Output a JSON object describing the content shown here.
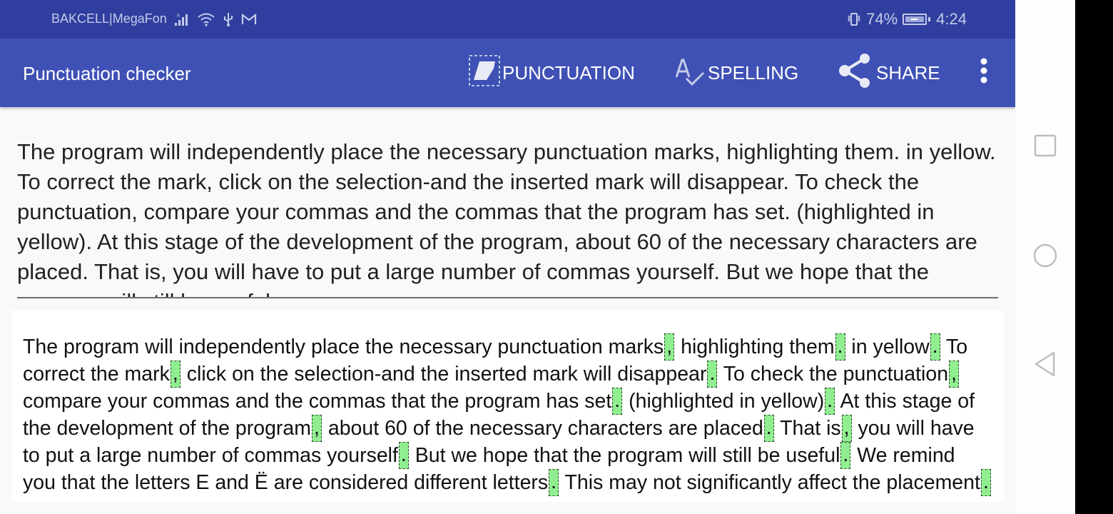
{
  "status_bar": {
    "carrier": "BAKCELL|MegaFon",
    "battery_percent": "74%",
    "time": "4:24",
    "icons_left": [
      "signal-icon",
      "wifi-icon",
      "usb-icon",
      "gmail-icon"
    ],
    "icons_right": [
      "vibrate-icon",
      "battery-charging-icon"
    ]
  },
  "app_bar": {
    "title": "Punctuation checker",
    "actions": {
      "punctuation": "PUNCTUATION",
      "spelling": "SPELLING",
      "share": "SHARE"
    }
  },
  "input": {
    "text": "The program will independently place the necessary punctuation marks, highlighting them. in yellow. To correct the mark, click on the selection-and the inserted mark will disappear. To check the punctuation, compare your commas and the commas that the program has set. (highlighted in yellow). At this stage of the development of the program, about 60 of the necessary characters are placed. That is, you will have to put a large number of commas yourself. But we hope that the program will still be useful."
  },
  "result": {
    "segments": [
      {
        "t": "The program will independently place the necessary punctuation marks"
      },
      {
        "m": ","
      },
      {
        "t": " highlighting them"
      },
      {
        "m": "."
      },
      {
        "t": " in yellow"
      },
      {
        "m": "."
      },
      {
        "t": " To correct the mark"
      },
      {
        "m": ","
      },
      {
        "t": " click on the selection-and the inserted mark will disappear"
      },
      {
        "m": "."
      },
      {
        "t": " To check the punctuation"
      },
      {
        "m": ","
      },
      {
        "t": " compare your commas and the commas that the program has set"
      },
      {
        "m": "."
      },
      {
        "t": " (highlighted in yellow)"
      },
      {
        "m": "."
      },
      {
        "t": " At this stage of the development of the program"
      },
      {
        "m": ","
      },
      {
        "t": " about 60 of the necessary characters are placed"
      },
      {
        "m": "."
      },
      {
        "t": " That is"
      },
      {
        "m": ","
      },
      {
        "t": " you will have to put a large number of commas yourself"
      },
      {
        "m": "."
      },
      {
        "t": " But we hope that the program will still be useful"
      },
      {
        "m": "."
      },
      {
        "t": " We remind you that the letters E and Ё are considered different letters"
      },
      {
        "m": "."
      },
      {
        "t": " This may not significantly affect the placement"
      },
      {
        "m": "."
      }
    ],
    "highlight_color": "#90ee90"
  },
  "nav_bar": {
    "recents": "recents-icon",
    "home": "home-icon",
    "back": "back-icon"
  },
  "colors": {
    "status_bar": "#303f9f",
    "app_bar": "#3f51b5",
    "mark_highlight": "#90ee90"
  }
}
